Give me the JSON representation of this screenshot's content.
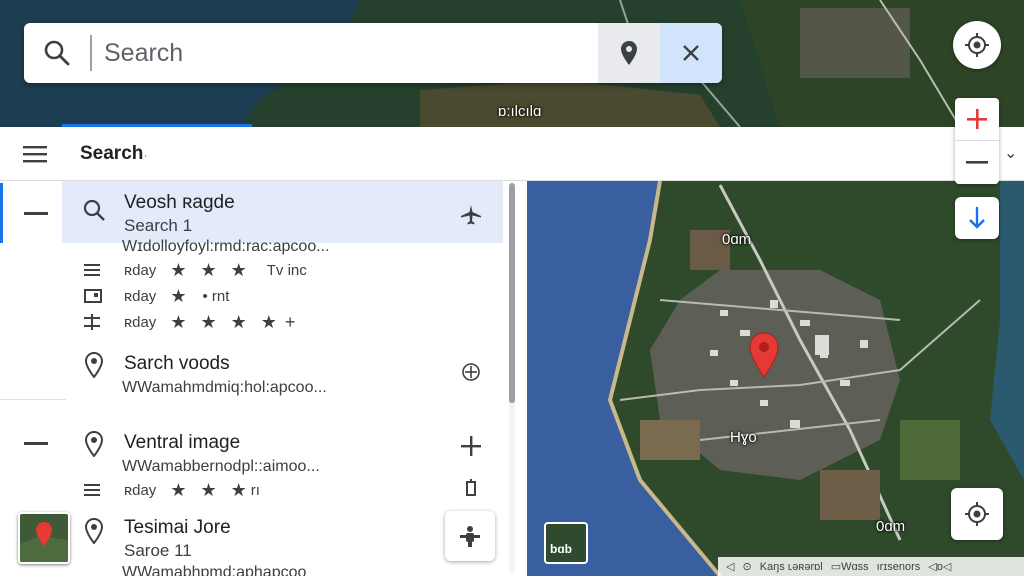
{
  "search": {
    "value": "Search ",
    "placeholder": ""
  },
  "panel": {
    "title": "Search",
    "title_suffix": "·"
  },
  "results": [
    {
      "title": "Veosh ʀagde",
      "subtitle": "Search 1",
      "address": "Wɪdolloyfoyl:rmd:rac:apcoo...",
      "ratings": [
        {
          "lead_icon": "list-icon",
          "label": "ʀday",
          "stars": 3,
          "extra": "Tv inc"
        },
        {
          "lead_icon": "card-icon",
          "label": "ʀday",
          "stars": 1,
          "extra": "• rnt"
        },
        {
          "lead_icon": "filter-icon",
          "label": "ʀday",
          "stars": 4,
          "extra": "+"
        }
      ]
    },
    {
      "title": "Sarch voods",
      "address": "WWamahmdmiq:hol:apcoo..."
    },
    {
      "title": "Ventral image",
      "address": "WWamabbernodpl::aimoo...",
      "ratings": [
        {
          "lead_icon": "list-icon",
          "label": "ʀday",
          "stars": 3,
          "extra": "rı"
        }
      ]
    },
    {
      "title": "Tesimai Jore",
      "subtitle": "Saroe 11",
      "address": "WWamabhpmd:aphapcoo"
    }
  ],
  "map_labels": [
    "ɒ:ılcılɑ",
    "0ɑm",
    "Hɣo",
    "0ɑm"
  ],
  "map_thumb_label": "bɑb",
  "attribution": [
    "◁",
    "⊙",
    "Kaŋs ʟəʀərɒl",
    "▭Wɑss",
    "ırɪsenors",
    "◁ɒ◁"
  ],
  "colors": {
    "accent": "#1a73e8",
    "pin": "#e53935",
    "zoom_in": "#e53935",
    "water": "#3a5fa0"
  }
}
